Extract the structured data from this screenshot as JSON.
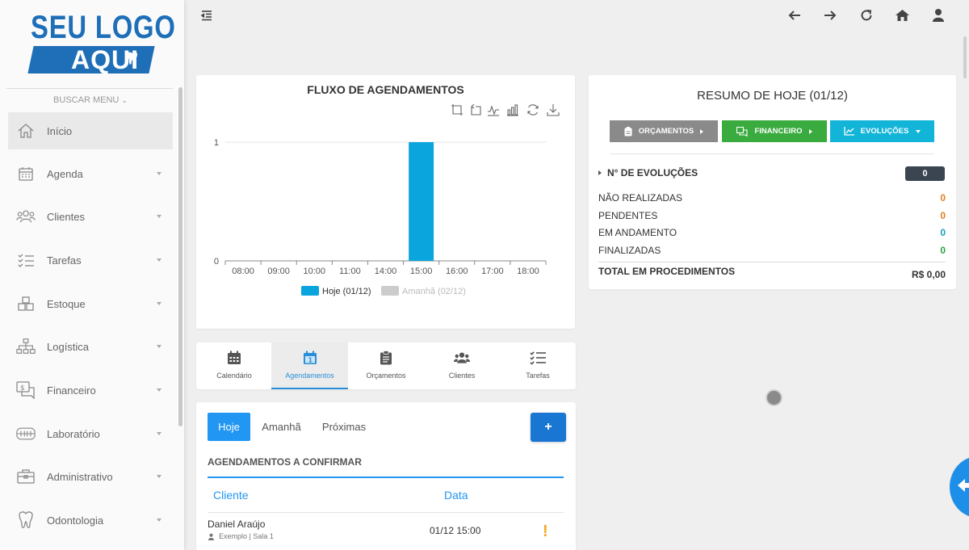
{
  "logo": {
    "line1": "SEU LOGO",
    "line2": "AQUI"
  },
  "sidebar": {
    "search_label": "BUSCAR MENU",
    "items": [
      {
        "label": "Início",
        "icon": "home-icon"
      },
      {
        "label": "Agenda",
        "icon": "calendar-icon"
      },
      {
        "label": "Clientes",
        "icon": "users-icon"
      },
      {
        "label": "Tarefas",
        "icon": "checklist-icon"
      },
      {
        "label": "Estoque",
        "icon": "boxes-icon"
      },
      {
        "label": "Logística",
        "icon": "sitemap-icon"
      },
      {
        "label": "Financeiro",
        "icon": "money-icon"
      },
      {
        "label": "Laboratório",
        "icon": "dentures-icon"
      },
      {
        "label": "Administrativo",
        "icon": "briefcase-icon"
      },
      {
        "label": "Odontologia",
        "icon": "tooth-icon"
      }
    ]
  },
  "chart_data": {
    "type": "bar",
    "title": "FLUXO DE AGENDAMENTOS",
    "categories": [
      "08:00",
      "09:00",
      "10:00",
      "11:00",
      "14:00",
      "15:00",
      "16:00",
      "17:00",
      "18:00"
    ],
    "series": [
      {
        "name": "Hoje (01/12)",
        "values": [
          0,
          0,
          0,
          0,
          0,
          1,
          0,
          0,
          0
        ],
        "color": "#0aa5dc"
      },
      {
        "name": "Amanhã (02/12)",
        "values": [
          0,
          0,
          0,
          0,
          0,
          0,
          0,
          0,
          0
        ],
        "color": "#cccccc"
      }
    ],
    "yticks": [
      "0",
      "1"
    ],
    "ylim": [
      0,
      1
    ],
    "legend": "bottom"
  },
  "resumo": {
    "title": "RESUMO DE HOJE (01/12)",
    "buttons": {
      "orcamentos": "ORÇAMENTOS",
      "financeiro": "FINANCEIRO",
      "evolucoes": "EVOLUÇÕES"
    },
    "evolucoes_label": "N° DE EVOLUÇÕES",
    "evolucoes_count": "0",
    "stats": [
      {
        "label": "NÃO REALIZADAS",
        "value": "0",
        "color": "#e67e22"
      },
      {
        "label": "PENDENTES",
        "value": "0",
        "color": "#e67e22"
      },
      {
        "label": "EM ANDAMENTO",
        "value": "0",
        "color": "#17a2b8"
      },
      {
        "label": "FINALIZADAS",
        "value": "0",
        "color": "#28a745"
      }
    ],
    "total_label": "TOTAL EM PROCEDIMENTOS",
    "total_value": "R$ 0,00"
  },
  "tabs": [
    {
      "label": "Calendário",
      "icon": "calendar-icon"
    },
    {
      "label": "Agendamentos",
      "icon": "calendar-day-icon"
    },
    {
      "label": "Orçamentos",
      "icon": "clipboard-icon"
    },
    {
      "label": "Clientes",
      "icon": "users-icon"
    },
    {
      "label": "Tarefas",
      "icon": "checklist-icon"
    }
  ],
  "agenda": {
    "day_tabs": [
      "Hoje",
      "Amanhã",
      "Próximas"
    ],
    "add_label": "+",
    "section_title": "AGENDAMENTOS A CONFIRMAR",
    "columns": {
      "cliente": "Cliente",
      "data": "Data"
    },
    "rows": [
      {
        "name": "Daniel Araújo",
        "sub": "Exemplo | Sala 1",
        "date": "01/12 15:00",
        "alert": "!"
      }
    ]
  },
  "colors": {
    "brand": "#1e6fb8",
    "accent": "#2196f3",
    "bar": "#0aa5dc",
    "gray_button": "#8a8a8a",
    "green_button": "#3aab3f",
    "cyan_button": "#12b4d8"
  }
}
